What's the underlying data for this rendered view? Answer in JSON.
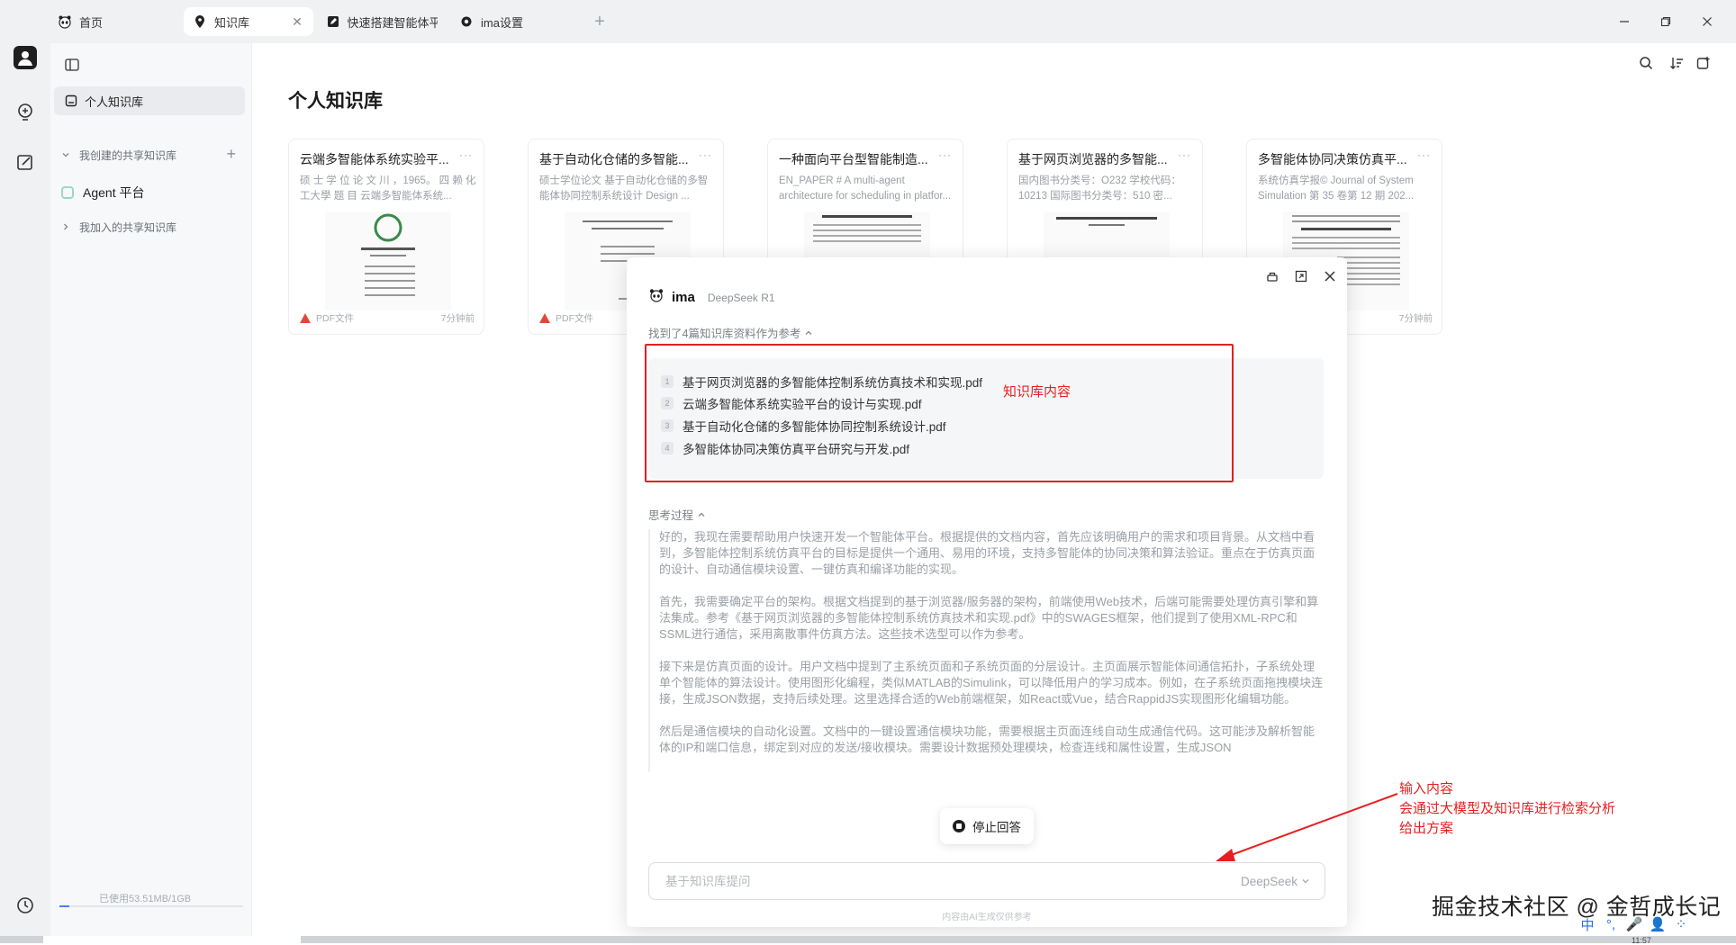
{
  "tabs": [
    {
      "label": "首页",
      "icon": "panda-icon",
      "active": false
    },
    {
      "label": "知识库",
      "icon": "location-pin-icon",
      "active": true
    },
    {
      "label": "快速搭建智能体平台",
      "icon": "edit-square-icon",
      "active": false
    },
    {
      "label": "ima设置",
      "icon": "settings-gear-icon",
      "active": false
    }
  ],
  "sidebar": {
    "personal_kb": "个人知识库",
    "created_shared": "我创建的共享知识库",
    "agent_item": "Agent 平台",
    "joined_shared": "我加入的共享知识库",
    "usage": "已使用53.51MB/1GB",
    "usage_fraction": 0.0523
  },
  "main": {
    "title": "个人知识库",
    "cards": [
      {
        "title": "云端多智能体系统实验平...",
        "desc": "硕 士 学 位 论 文 川 ，1965。 四 赖 化工大學 题 目 云端多智能体系统...",
        "type": "PDF文件",
        "time": "7分钟前"
      },
      {
        "title": "基于自动化仓储的多智能...",
        "desc": "硕士学位论文 基于自动化仓储的多智能体协同控制系统设计 Design ...",
        "type": "PDF文件",
        "time": ""
      },
      {
        "title": "一种面向平台型智能制造...",
        "desc": "EN_PAPER # A multi-agent architecture for scheduling in platfor...",
        "type": "",
        "time": ""
      },
      {
        "title": "基于网页浏览器的多智能...",
        "desc": "国内图书分类号：O232 学校代码：10213 国际图书分类号：510 密...",
        "type": "",
        "time": ""
      },
      {
        "title": "多智能体协同决策仿真平...",
        "desc": "系统仿真学报© Journal of System Simulation 第 35 卷第 12 期 202...",
        "type": "",
        "time": "7分钟前"
      }
    ]
  },
  "chat": {
    "brand": "ima",
    "model": "DeepSeek R1",
    "refs_header": "找到了4篇知识库资料作为参考",
    "refs": [
      {
        "num": "1",
        "name": "基于网页浏览器的多智能体控制系统仿真技术和实现.pdf"
      },
      {
        "num": "2",
        "name": "云端多智能体系统实验平台的设计与实现.pdf"
      },
      {
        "num": "3",
        "name": "基于自动化仓储的多智能体协同控制系统设计.pdf"
      },
      {
        "num": "4",
        "name": "多智能体协同决策仿真平台研究与开发.pdf"
      }
    ],
    "kb_annotation": "知识库内容",
    "think_header": "思考过程",
    "think_paragraphs": [
      "好的，我现在需要帮助用户快速开发一个智能体平台。根据提供的文档内容，首先应该明确用户的需求和项目背景。从文档中看到，多智能体控制系统仿真平台的目标是提供一个通用、易用的环境，支持多智能体的协同决策和算法验证。重点在于仿真页面的设计、自动通信模块设置、一键仿真和编译功能的实现。",
      "首先，我需要确定平台的架构。根据文档提到的基于浏览器/服务器的架构，前端使用Web技术，后端可能需要处理仿真引擎和算法集成。参考《基于网页浏览器的多智能体控制系统仿真技术和实现.pdf》中的SWAGES框架，他们提到了使用XML-RPC和SSML进行通信，采用离散事件仿真方法。这些技术选型可以作为参考。",
      "接下来是仿真页面的设计。用户文档中提到了主系统页面和子系统页面的分层设计。主页面展示智能体间通信拓扑，子系统处理单个智能体的算法设计。使用图形化编程，类似MATLAB的Simulink，可以降低用户的学习成本。例如，在子系统页面拖拽模块连接，生成JSON数据，支持后续处理。这里选择合适的Web前端框架，如React或Vue，结合RappidJS实现图形化编辑功能。",
      "然后是通信模块的自动化设置。文档中的一键设置通信模块功能，需要根据主页面连线自动生成通信代码。这可能涉及解析智能体的IP和端口信息，绑定到对应的发送/接收模块。需要设计数据预处理模块，检查连线和属性设置，生成JSON"
    ],
    "stop_label": "停止回答",
    "input_placeholder": "基于知识库提问",
    "input_model": "DeepSeek",
    "disclaimer": "内容由AI生成仅供参考"
  },
  "annotation": {
    "lines": [
      "输入内容",
      "会通过大模型及知识库进行检索分析",
      "给出方案"
    ]
  },
  "watermark": "掘金技术社区 @ 金哲成长记",
  "ime": [
    "中",
    "°,",
    "🎤",
    "👤",
    "⁘"
  ],
  "clock": "11:57",
  "colors": {
    "annotation_red": "#e62020",
    "accent_blue": "#4f7cff"
  }
}
